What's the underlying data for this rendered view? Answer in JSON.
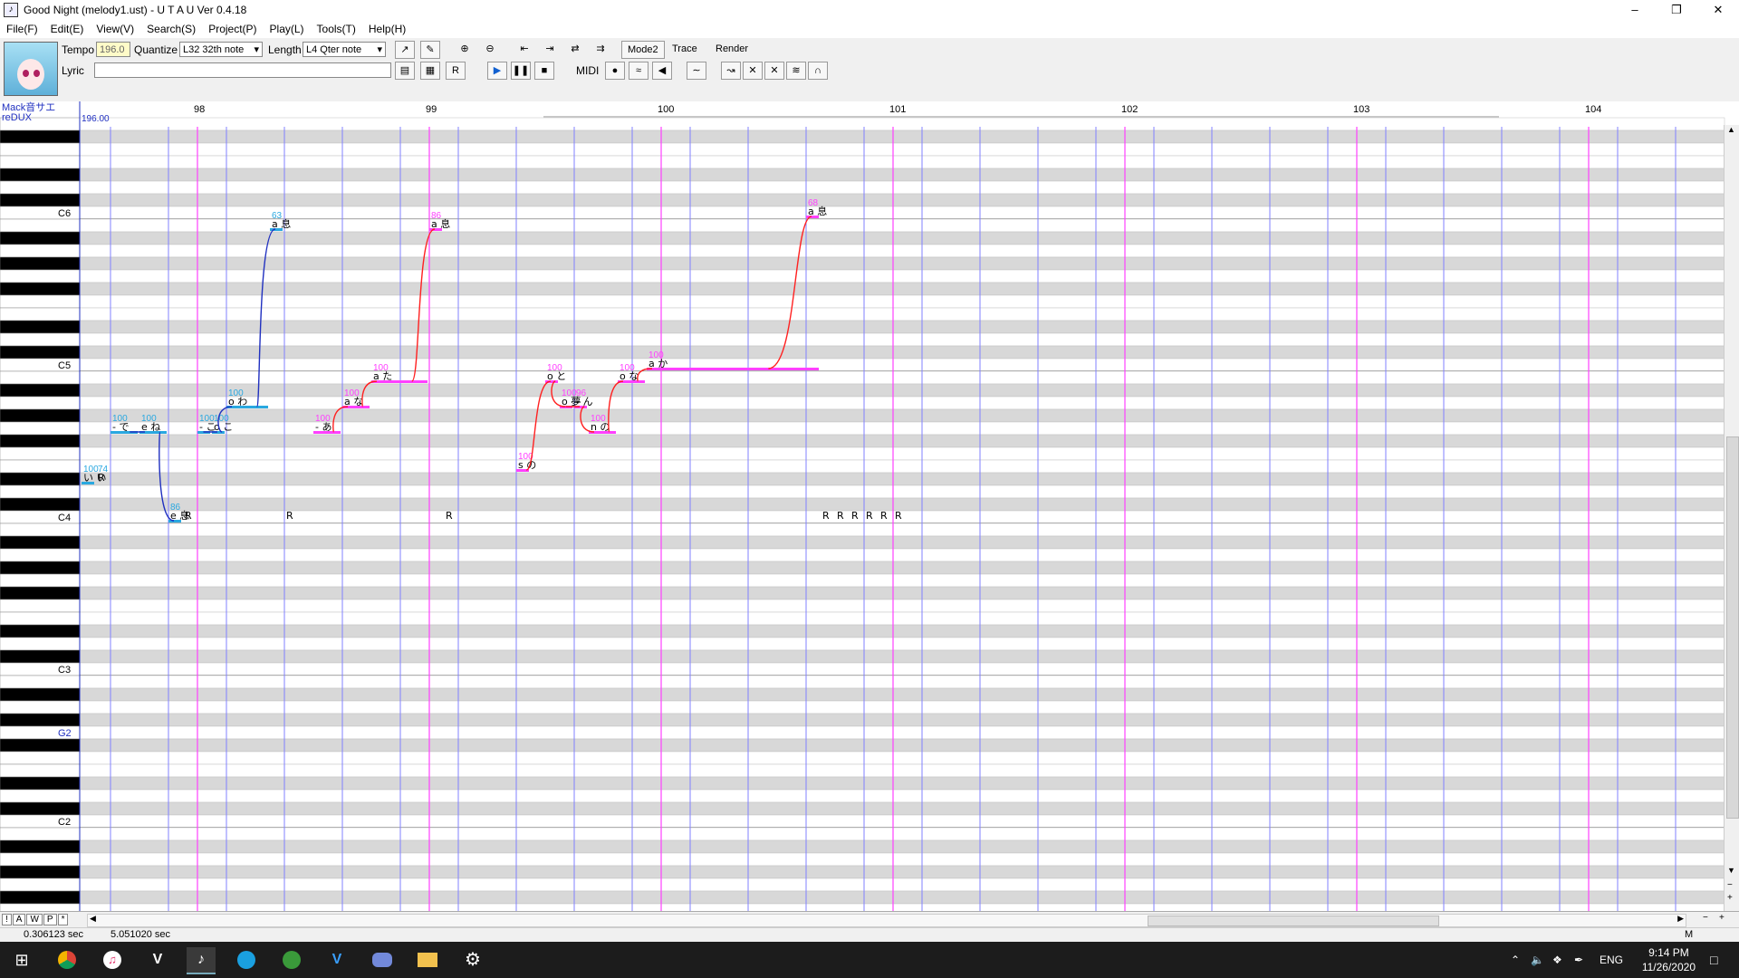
{
  "window": {
    "title": "Good Night (melody1.ust) - U T A U Ver 0.4.18",
    "minimize": "–",
    "maximize": "❐",
    "close": "✕"
  },
  "menu": [
    "File(F)",
    "Edit(E)",
    "View(V)",
    "Search(S)",
    "Project(P)",
    "Play(L)",
    "Tools(T)",
    "Help(H)"
  ],
  "toolbar": {
    "tempo_label": "Tempo",
    "tempo_value": "196.0",
    "quantize_label": "Quantize",
    "quantize_value": "L32 32th note",
    "length_label": "Length",
    "length_value": "L4  Qter note",
    "lyric_label": "Lyric",
    "lyric_value": "",
    "midi_label": "MIDI",
    "mode2_label": "Mode2",
    "trace_label": "Trace",
    "render_label": "Render"
  },
  "voicebank": {
    "line1": "Mack音サエ",
    "line2": "reDUX"
  },
  "tempo_marker": "196.00",
  "measures": [
    "98",
    "99",
    "100",
    "101",
    "102",
    "103",
    "104"
  ],
  "octave_labels": {
    "C6": "C6",
    "C5": "C5",
    "C4": "C4",
    "C3": "C3",
    "G2": "G2",
    "C2": "C2"
  },
  "notes_blue": [
    {
      "lyric": "い い",
      "vel": "100",
      "t": 0.0,
      "d": 0.25,
      "p": 63
    },
    {
      "lyric": "R",
      "vel": "74",
      "t": 0.25,
      "d": 0.25,
      "p": 63
    },
    {
      "lyric": "- で",
      "vel": "100",
      "t": 0.5,
      "d": 0.5,
      "p": 67
    },
    {
      "lyric": "e ね",
      "vel": "100",
      "t": 1.0,
      "d": 0.5,
      "p": 67
    },
    {
      "lyric": "e 息",
      "vel": "86",
      "t": 1.5,
      "d": 0.25,
      "p": 60
    },
    {
      "lyric": "R",
      "vel": "",
      "t": 1.75,
      "d": 0.25,
      "p": 60
    },
    {
      "lyric": "- こ",
      "vel": "100",
      "t": 2.0,
      "d": 0.25,
      "p": 67
    },
    {
      "lyric": "o こ",
      "vel": "100",
      "t": 2.25,
      "d": 0.25,
      "p": 67
    },
    {
      "lyric": "o わ",
      "vel": "100",
      "t": 2.5,
      "d": 0.75,
      "p": 69
    },
    {
      "lyric": "a 息",
      "vel": "63",
      "t": 3.25,
      "d": 0.15,
      "p": 83
    },
    {
      "lyric": "R",
      "vel": "",
      "t": 3.5,
      "d": 0.25,
      "p": 60
    }
  ],
  "notes_pink": [
    {
      "lyric": "- あ",
      "vel": "100",
      "t": 4.0,
      "d": 0.5,
      "p": 67
    },
    {
      "lyric": "a な",
      "vel": "100",
      "t": 4.5,
      "d": 0.5,
      "p": 69
    },
    {
      "lyric": "a た",
      "vel": "100",
      "t": 5.0,
      "d": 1.0,
      "p": 71
    },
    {
      "lyric": "a 息",
      "vel": "86",
      "t": 6.0,
      "d": 0.25,
      "p": 83
    },
    {
      "lyric": "R",
      "vel": "",
      "t": 6.25,
      "d": 0.25,
      "p": 60
    },
    {
      "lyric": "s の",
      "vel": "100",
      "t": 7.5,
      "d": 0.25,
      "p": 64
    },
    {
      "lyric": "o と",
      "vel": "100",
      "t": 8.0,
      "d": 0.25,
      "p": 71
    },
    {
      "lyric": "o 夢",
      "vel": "100",
      "t": 8.25,
      "d": 0.25,
      "p": 69
    },
    {
      "lyric": "- ん",
      "vel": "96",
      "t": 8.5,
      "d": 0.25,
      "p": 69
    },
    {
      "lyric": "n の",
      "vel": "100",
      "t": 8.75,
      "d": 0.5,
      "p": 67
    },
    {
      "lyric": "o な",
      "vel": "100",
      "t": 9.25,
      "d": 0.5,
      "p": 71
    },
    {
      "lyric": "a か",
      "vel": "100",
      "t": 9.75,
      "d": 3.0,
      "p": 72
    },
    {
      "lyric": "a 息",
      "vel": "68",
      "t": 12.5,
      "d": 0.25,
      "p": 84
    },
    {
      "lyric": "R",
      "vel": "",
      "t": 12.75,
      "d": 0.25,
      "p": 60
    },
    {
      "lyric": "R",
      "vel": "",
      "t": 13.0,
      "d": 0.25,
      "p": 60
    },
    {
      "lyric": "R",
      "vel": "",
      "t": 13.25,
      "d": 0.25,
      "p": 60
    },
    {
      "lyric": "R",
      "vel": "",
      "t": 13.5,
      "d": 0.25,
      "p": 60
    },
    {
      "lyric": "R",
      "vel": "",
      "t": 13.75,
      "d": 0.25,
      "p": 60
    },
    {
      "lyric": "R",
      "vel": "",
      "t": 14.0,
      "d": 0.25,
      "p": 60
    }
  ],
  "bottom_buttons": [
    "!",
    "A",
    "W",
    "P",
    "*"
  ],
  "status": {
    "left": "0.306123 sec",
    "mid": "5.051020 sec",
    "right": "M"
  },
  "taskbar": {
    "lang": "ENG",
    "time": "9:14 PM",
    "date": "11/26/2020"
  }
}
